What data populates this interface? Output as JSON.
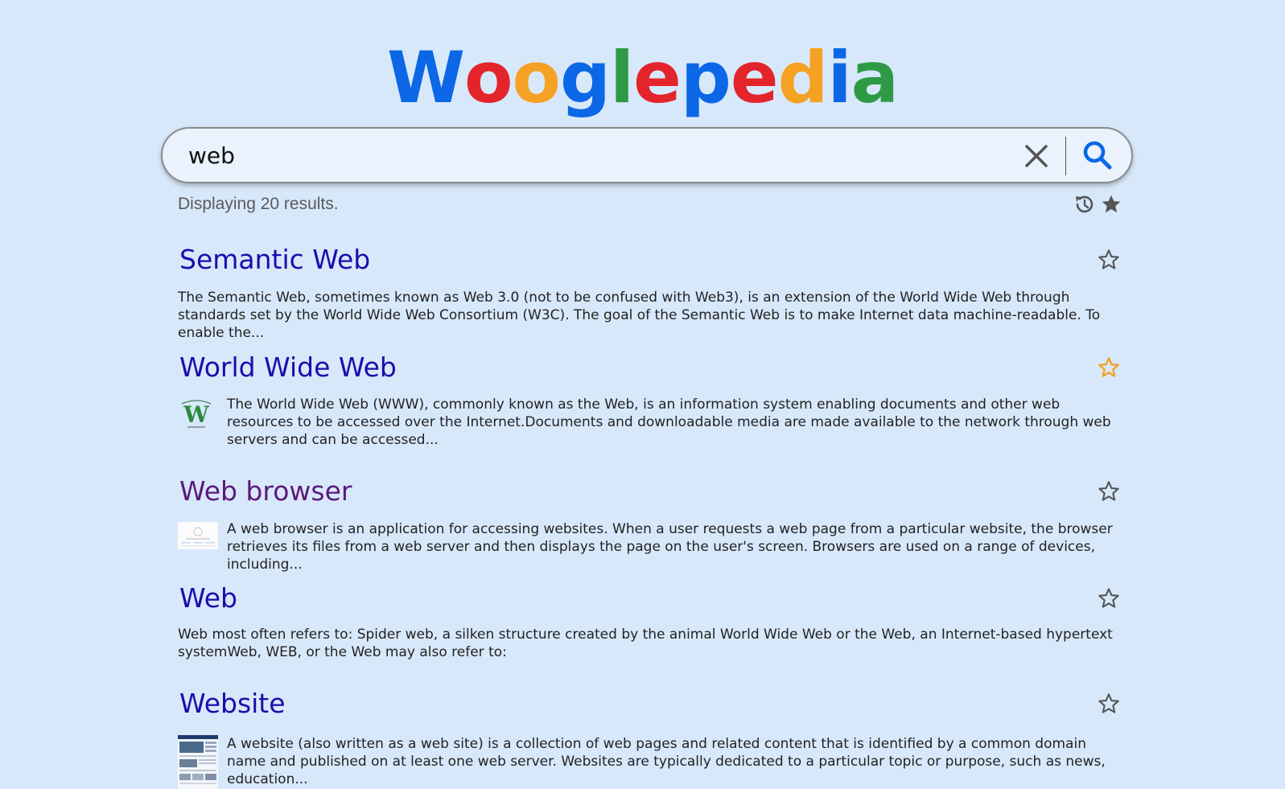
{
  "logo": {
    "letters": [
      {
        "char": "W",
        "color": "#0b67e6"
      },
      {
        "char": "o",
        "color": "#e3242b"
      },
      {
        "char": "o",
        "color": "#f5a123"
      },
      {
        "char": "g",
        "color": "#0b67e6"
      },
      {
        "char": "l",
        "color": "#2e9a45"
      },
      {
        "char": "e",
        "color": "#e3242b"
      },
      {
        "char": "p",
        "color": "#0b67e6"
      },
      {
        "char": "e",
        "color": "#e3242b"
      },
      {
        "char": "d",
        "color": "#f5a123"
      },
      {
        "char": "i",
        "color": "#0b67e6"
      },
      {
        "char": "a",
        "color": "#2e9a45"
      }
    ]
  },
  "search": {
    "value": "web",
    "clear_icon": "close-icon",
    "search_icon": "search-icon"
  },
  "results_summary": "Displaying 20 results.",
  "toolbar": {
    "history_icon": "history-icon",
    "favorites_icon": "star-filled-icon"
  },
  "colors": {
    "link": "#1a0dab",
    "visited_link": "#5a1a78",
    "star_favorited": "#f5a123",
    "star_default": "#555555"
  },
  "results": [
    {
      "title": "Semantic Web",
      "visited": false,
      "favorited": false,
      "thumbnail": null,
      "snippet": "The Semantic Web, sometimes known as Web 3.0 (not to be confused with Web3), is an extension of the World Wide Web through standards set by the World Wide Web Consortium (W3C). The goal of the Semantic Web is to make Internet data machine-readable. To enable the..."
    },
    {
      "title": "World Wide Web",
      "visited": false,
      "favorited": true,
      "thumbnail": "www-logo",
      "snippet": "The World Wide Web (WWW), commonly known as the Web, is an information system enabling documents and other web resources to be accessed over the Internet.Documents and downloadable media are made available to the network through web servers and can be accessed..."
    },
    {
      "title": "Web browser",
      "visited": true,
      "favorited": false,
      "thumbnail": "browser-screenshot",
      "snippet": "A web browser is an application for accessing websites. When a user requests a web page from a particular website, the browser retrieves its files from a web server and then displays the page on the user's screen. Browsers are used on a range of devices, including..."
    },
    {
      "title": "Web",
      "visited": false,
      "favorited": false,
      "thumbnail": null,
      "snippet": "Web most often refers to: Spider web, a silken structure created by the animal World Wide Web or the Web, an Internet-based hypertext systemWeb, WEB, or the Web may also refer to:"
    },
    {
      "title": "Website",
      "visited": false,
      "favorited": false,
      "thumbnail": "website-screenshot",
      "snippet": "A website (also written as a web site) is a collection of web pages and related content that is identified by a common domain name and published on at least one web server. Websites are typically dedicated to a particular topic or purpose, such as news, education..."
    }
  ]
}
